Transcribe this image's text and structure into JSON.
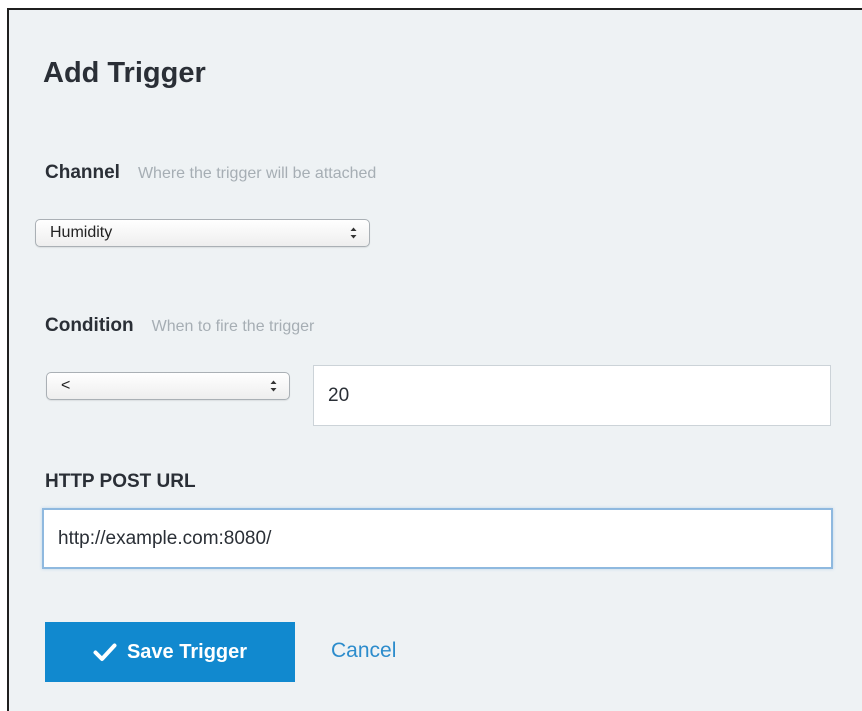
{
  "form": {
    "title": "Add Trigger",
    "channel": {
      "label": "Channel",
      "hint": "Where the trigger will be attached",
      "selected": "Humidity"
    },
    "condition": {
      "label": "Condition",
      "hint": "When to fire the trigger",
      "operator": "<",
      "value": "20"
    },
    "post_url": {
      "label": "HTTP POST URL",
      "value": "http://example.com:8080/"
    },
    "actions": {
      "save_label": "Save Trigger",
      "save_icon": "checkmark-icon",
      "cancel_label": "Cancel"
    }
  },
  "colors": {
    "background": "#eef2f4",
    "primary": "#1189cf",
    "link": "#2c8ccc",
    "focus_border": "#8fb9df"
  }
}
